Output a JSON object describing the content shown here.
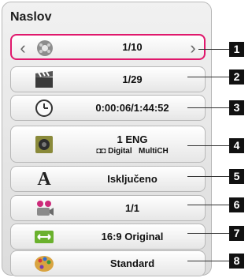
{
  "menu": {
    "title": "Naslov",
    "rows": [
      {
        "value": "1/10",
        "badge": "1",
        "icon": "film-reel-icon"
      },
      {
        "value": "1/29",
        "badge": "2",
        "icon": "clapperboard-icon"
      },
      {
        "value": "0:00:06/1:44:52",
        "badge": "3",
        "icon": "clock-icon"
      },
      {
        "value": "1 ENG",
        "sub_left": "Digital",
        "sub_right": "MultiCH",
        "badge": "4",
        "icon": "speaker-icon"
      },
      {
        "value": "Isključeno",
        "badge": "5",
        "icon": "subtitle-a-icon"
      },
      {
        "value": "1/1",
        "badge": "6",
        "icon": "camera-angle-icon"
      },
      {
        "value": "16:9 Original",
        "badge": "7",
        "icon": "aspect-ratio-icon"
      },
      {
        "value": "Standard",
        "badge": "8",
        "icon": "palette-icon"
      }
    ]
  },
  "colors": {
    "selection": "#e0186c"
  }
}
